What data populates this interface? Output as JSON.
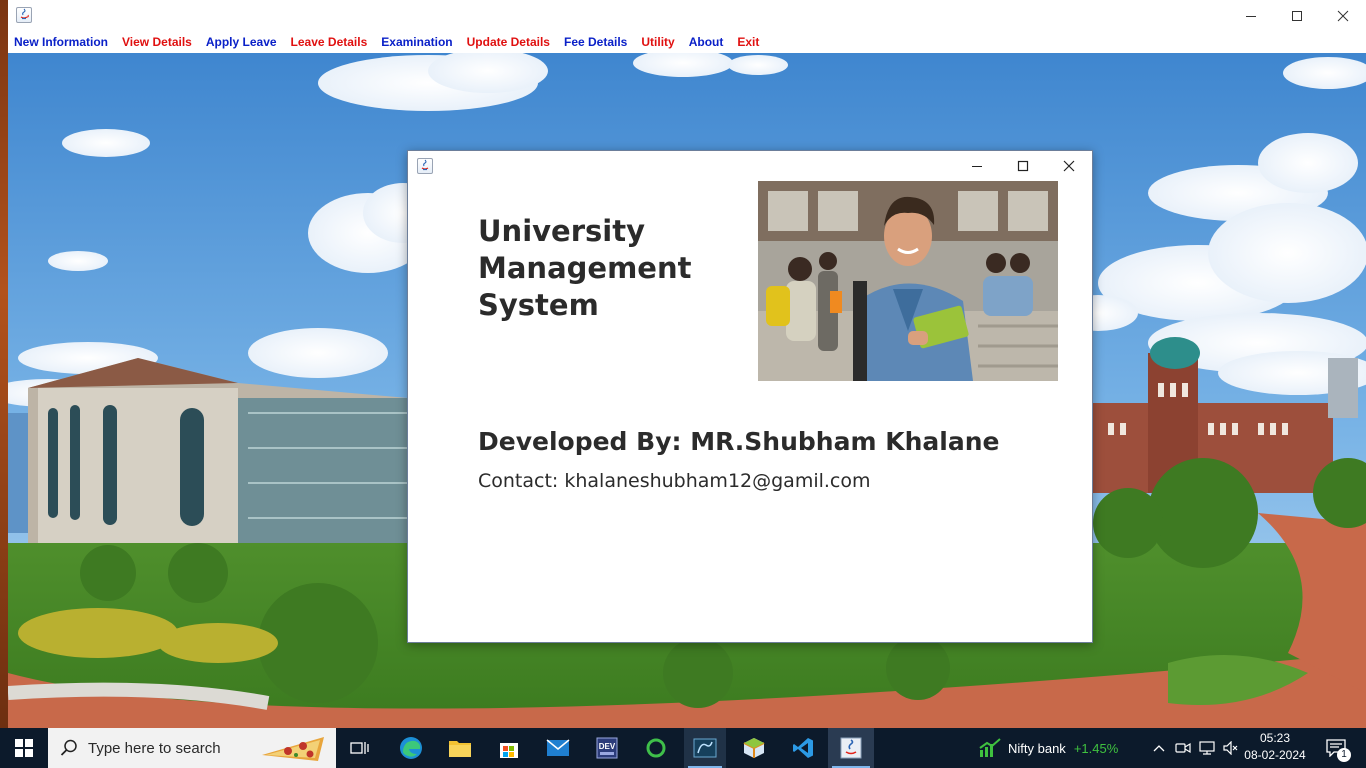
{
  "main_window": {
    "title": "",
    "controls": {
      "minimize": "minimize",
      "maximize": "maximize",
      "close": "close"
    }
  },
  "menu": {
    "items": [
      {
        "label": "New Information",
        "color": "#0a20c8"
      },
      {
        "label": "View Details",
        "color": "#e01010"
      },
      {
        "label": "Apply Leave",
        "color": "#0a20c8"
      },
      {
        "label": "Leave Details",
        "color": "#e01010"
      },
      {
        "label": "Examination",
        "color": "#0a20c8"
      },
      {
        "label": "Update Details",
        "color": "#e01010"
      },
      {
        "label": "Fee Details",
        "color": "#0a20c8"
      },
      {
        "label": "Utility",
        "color": "#e01010"
      },
      {
        "label": "About",
        "color": "#0a20c8"
      },
      {
        "label": "Exit",
        "color": "#e01010"
      }
    ]
  },
  "about": {
    "title_lines": [
      "University",
      "Management",
      "System"
    ],
    "developer": "Developed By: MR.Shubham Khalane",
    "contact": "Contact: khalaneshubham12@gamil.com"
  },
  "taskbar": {
    "search_placeholder": "Type here to search",
    "apps": [
      "task-view",
      "edge",
      "file-explorer",
      "microsoft-store",
      "mail",
      "dev-cpp",
      "refresh-app",
      "mysql-workbench",
      "netbeans",
      "vs-code",
      "java"
    ],
    "widget_name": "Nifty bank",
    "widget_change": "+1.45%",
    "widget_change_color": "#3fc13f",
    "time": "05:23",
    "date": "08-02-2024",
    "notification_count": "1"
  },
  "colors": {
    "accent": "#0a20c8",
    "alert": "#e01010",
    "taskbar": "#0c1a2b"
  }
}
